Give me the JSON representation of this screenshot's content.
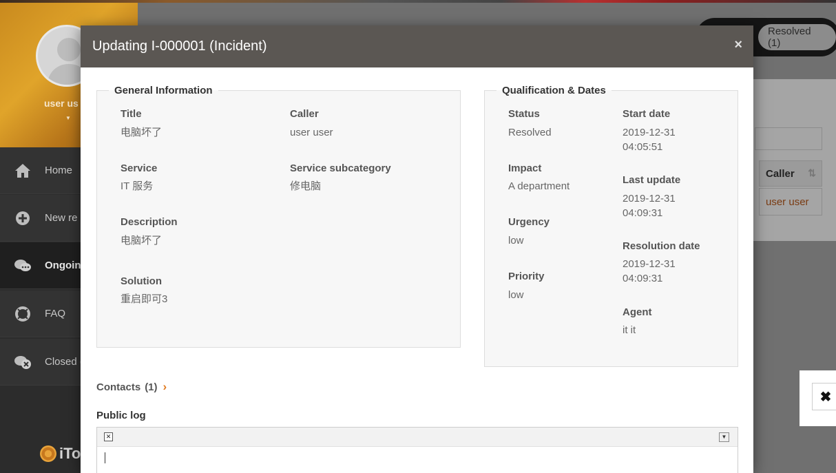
{
  "sidebar": {
    "user_name": "user us",
    "items": [
      {
        "label": "Home",
        "icon": "home-icon"
      },
      {
        "label": "New re",
        "icon": "plus-circle-icon"
      },
      {
        "label": "Ongoin",
        "icon": "chat-bubbles-icon",
        "active": true
      },
      {
        "label": "FAQ",
        "icon": "lifebuoy-icon"
      },
      {
        "label": "Closed (",
        "icon": "chat-closed-icon"
      }
    ],
    "logo_text": "iTo"
  },
  "background": {
    "filter_resolved": "Resolved  (1)",
    "table_header_caller": "Caller",
    "table_cell_caller": "user user"
  },
  "modal": {
    "title": "Updating I-000001 (Incident)",
    "close_glyph": "×",
    "general": {
      "legend": "General Information",
      "title_label": "Title",
      "title_value": "电脑坏了",
      "caller_label": "Caller",
      "caller_value": "user user",
      "service_label": "Service",
      "service_value": "IT 服务",
      "subcategory_label": "Service subcategory",
      "subcategory_value": "修电脑",
      "description_label": "Description",
      "description_value": "电脑坏了",
      "solution_label": "Solution",
      "solution_value": "重启即可3"
    },
    "qualification": {
      "legend": "Qualification & Dates",
      "status_label": "Status",
      "status_value": "Resolved",
      "start_label": "Start date",
      "start_date": "2019-12-31",
      "start_time": "04:05:51",
      "impact_label": "Impact",
      "impact_value": "A department",
      "last_update_label": "Last update",
      "last_update_date": "2019-12-31",
      "last_update_time": "04:09:31",
      "urgency_label": "Urgency",
      "urgency_value": "low",
      "resolution_label": "Resolution date",
      "resolution_date": "2019-12-31",
      "resolution_time": "04:09:31",
      "priority_label": "Priority",
      "priority_value": "low",
      "agent_label": "Agent",
      "agent_value": "it it"
    },
    "contacts_label": "Contacts",
    "contacts_count": "(1)",
    "public_log_label": "Public log"
  },
  "colors": {
    "modal_header": "#5b5753",
    "accent": "#e07a1f"
  }
}
